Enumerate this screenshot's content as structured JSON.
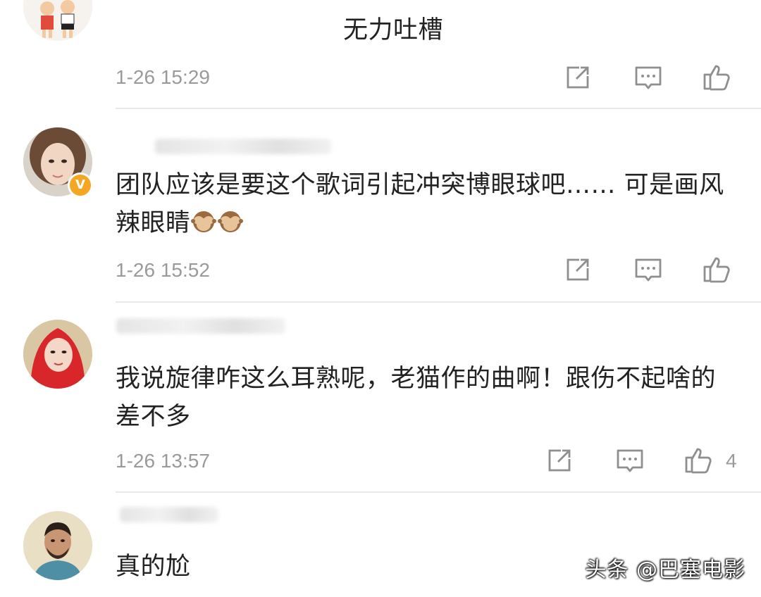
{
  "comments": [
    {
      "text": "无力吐槽",
      "time": "1-26 15:29",
      "likes": "",
      "avatar": "avatar-cartoon-kids",
      "verified": false
    },
    {
      "text": "团队应该是要这个歌词引起冲突博眼球吧…… 可是画风辣眼睛",
      "emoji": [
        "see-no-evil-monkey-icon",
        "see-no-evil-monkey-icon"
      ],
      "time": "1-26 15:52",
      "likes": "",
      "avatar": "avatar-woman-portrait",
      "verified": true
    },
    {
      "text": "我说旋律咋这么耳熟呢，老猫作的曲啊！跟伤不起啥的差不多",
      "time": "1-26 13:57",
      "likes": "4",
      "avatar": "avatar-woman-red-veil",
      "verified": false
    },
    {
      "text": "真的尬",
      "avatar": "avatar-man-portrait",
      "verified": false
    }
  ],
  "icons": [
    "share-icon",
    "comment-icon",
    "like-icon"
  ],
  "watermark": "头条 @巴塞电影",
  "colors": {
    "text": "#222222",
    "meta": "#9a9a9a",
    "icon": "#8f8f8f",
    "verified": "#f5a623",
    "divider": "#e9e9e9"
  }
}
